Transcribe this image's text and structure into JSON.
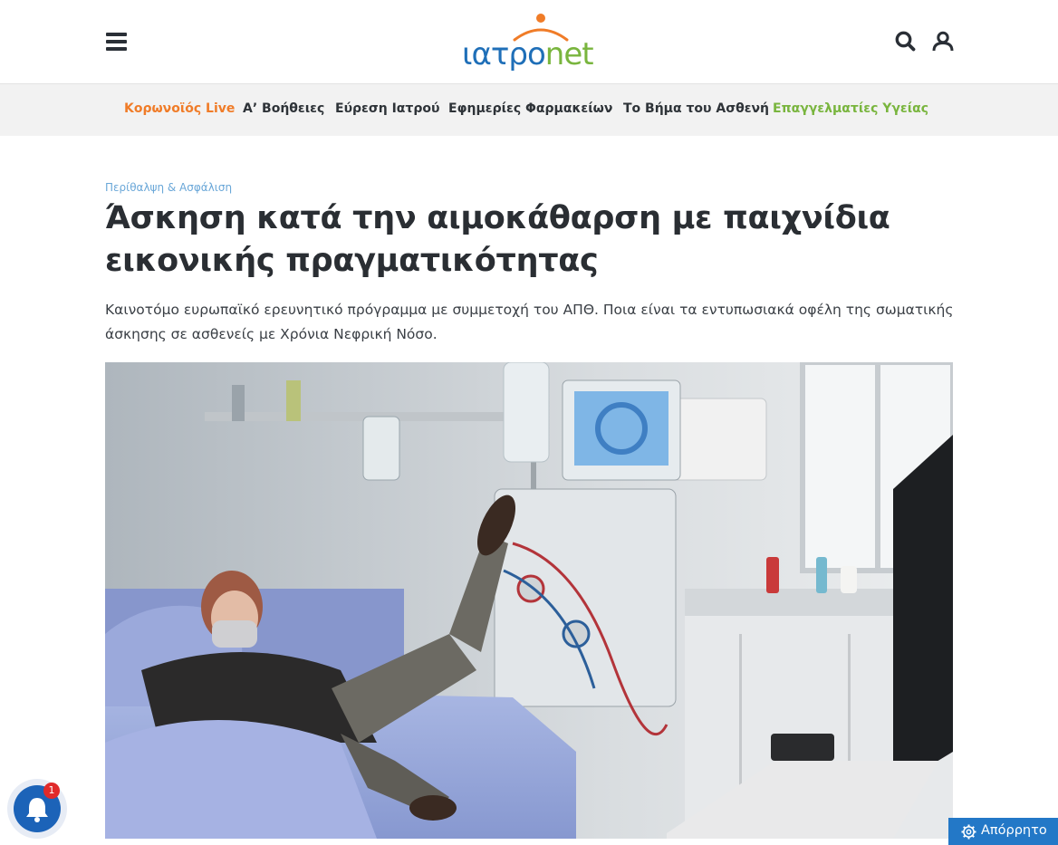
{
  "header": {
    "logo_text": "ιατρονet",
    "menu_icon": "hamburger-menu-icon",
    "search_icon": "search-icon",
    "account_icon": "user-icon"
  },
  "nav": {
    "items": [
      {
        "label": "Κορωνοϊός Live",
        "color": "#f07c28"
      },
      {
        "label": "Α’ Βοήθειες",
        "color": "#2e3338"
      },
      {
        "label": "Εύρεση Ιατρού",
        "color": "#2e3338"
      },
      {
        "label": "Εφημερίες Φαρμακείων",
        "color": "#2e3338"
      },
      {
        "label": "Το Βήμα του Ασθενή",
        "color": "#2e3338"
      },
      {
        "label": "Επαγγελματίες Υγείας",
        "color": "#79b53e"
      }
    ]
  },
  "article": {
    "category": "Περίθαλψη & Ασφάλιση",
    "title": "Άσκηση κατά την αιμοκάθαρση με παιχνίδια εικονικής πραγματικότητας",
    "lead": "Καινοτόμο ευρωπαϊκό ερευνητικό πρόγραμμα με συμμετοχή του ΑΠΘ. Ποια είναι τα εντυπωσιακά οφέλη της σωματικής άσκησης σε ασθενείς με Χρόνια Νεφρική Νόσο."
  },
  "notifications": {
    "badge_count": "1",
    "icon": "bell-icon"
  },
  "privacy": {
    "label": "Απόρρητο",
    "icon": "gear-icon"
  },
  "colors": {
    "accent_orange": "#f07c28",
    "accent_blue": "#1f6fb8",
    "accent_green": "#79b53e",
    "category_blue": "#6aa7d8"
  }
}
